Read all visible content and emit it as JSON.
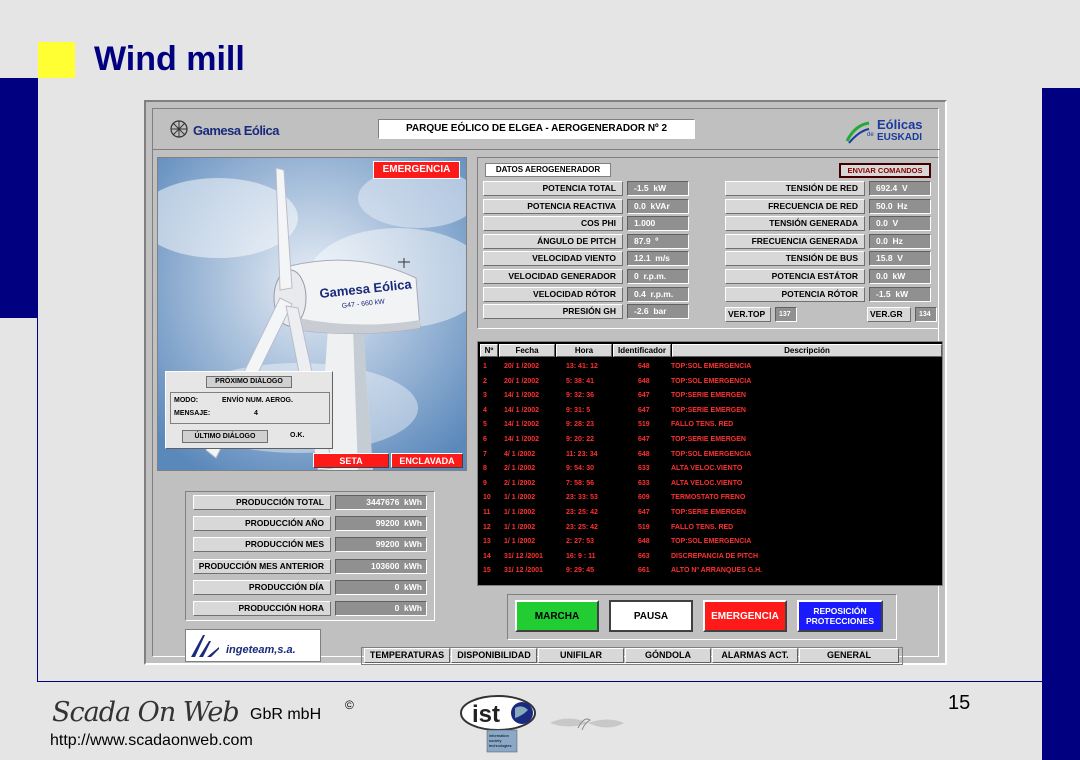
{
  "slide": {
    "title": "Wind mill",
    "page_number": "15",
    "company": "GbR mbH",
    "copyright": "©",
    "url": "http://www.scadaonweb.com",
    "logo_text": "Scada On Web",
    "ist_logo_text": "ist",
    "ist_sub": "information society technologies"
  },
  "scada": {
    "brand_left": "Gamesa Eólica",
    "title": "PARQUE EÓLICO DE ELGEA - AEROGENERADOR Nº 2",
    "brand_right_top": "Eólicas",
    "brand_right_de": "de",
    "brand_right_bottom": "EUSKADI",
    "turbine_text": "Gamesa Eólica",
    "turbine_model": "G47 - 660 kW",
    "emergency_badge": "EMERGENCIA",
    "dialog": {
      "title": "PRÓXIMO DIÁLOGO",
      "modo_label": "MODO:",
      "modo_value": "ENVÍO NUM. AEROG.",
      "mensaje_label": "MENSAJE:",
      "mensaje_value": "4",
      "ultimo_label": "ÚLTIMO DIÁLOGO",
      "ultimo_value": "O.K."
    },
    "seta": "SETA",
    "enclavada": "ENCLAVADA",
    "datos_title": "DATOS AEROGENERADOR",
    "enviar": "ENVIAR COMANDOS",
    "left_params": [
      {
        "label": "POTENCIA TOTAL",
        "value": "-1.5  kW"
      },
      {
        "label": "POTENCIA REACTIVA",
        "value": "0.0  kVAr"
      },
      {
        "label": "COS PHI",
        "value": "1.000"
      },
      {
        "label": "ÁNGULO DE PITCH",
        "value": "87.9  º"
      },
      {
        "label": "VELOCIDAD VIENTO",
        "value": "12.1  m/s"
      },
      {
        "label": "VELOCIDAD GENERADOR",
        "value": "0  r.p.m."
      },
      {
        "label": "VELOCIDAD RÓTOR",
        "value": "0.4  r.p.m."
      },
      {
        "label": "PRESIÓN GH",
        "value": "-2.6  bar"
      }
    ],
    "right_params": [
      {
        "label": "TENSIÓN DE RED",
        "value": "692.4  V"
      },
      {
        "label": "FRECUENCIA DE RED",
        "value": "50.0  Hz"
      },
      {
        "label": "TENSIÓN GENERADA",
        "value": "0.0  V"
      },
      {
        "label": "FRECUENCIA GENERADA",
        "value": "0.0  Hz"
      },
      {
        "label": "TENSIÓN DE BUS",
        "value": "15.8  V"
      },
      {
        "label": "POTENCIA ESTÁTOR",
        "value": "0.0  kW"
      },
      {
        "label": "POTENCIA RÓTOR",
        "value": "-1.5  kW"
      }
    ],
    "ver_top_label": "VER.TOP",
    "ver_top_value": "137",
    "ver_gr_label": "VER.GR",
    "ver_gr_value": "134",
    "produccion": [
      {
        "label": "PRODUCCIÓN TOTAL",
        "value": "3447676  kWh"
      },
      {
        "label": "PRODUCCIÓN AÑO",
        "value": "99200  kWh"
      },
      {
        "label": "PRODUCCIÓN MES",
        "value": "99200  kWh"
      },
      {
        "label": "PRODUCCIÓN MES ANTERIOR",
        "value": "103600  kWh"
      },
      {
        "label": "PRODUCCIÓN DÍA",
        "value": "0  kWh"
      },
      {
        "label": "PRODUCCIÓN HORA",
        "value": "0  kWh"
      }
    ],
    "alarm_headers": [
      "Nº",
      "Fecha",
      "Hora",
      "Identificador",
      "Descripción"
    ],
    "alarms": [
      {
        "n": "1",
        "fecha": "20/  1  /2002",
        "hora": "13: 41: 12",
        "id": "648",
        "desc": "TOP:SOL EMERGENCIA"
      },
      {
        "n": "2",
        "fecha": "20/  1  /2002",
        "hora": "5: 38: 41",
        "id": "648",
        "desc": "TOP:SOL EMERGENCIA"
      },
      {
        "n": "3",
        "fecha": "14/  1  /2002",
        "hora": "9: 32: 36",
        "id": "647",
        "desc": "TOP:SERIE EMERGEN"
      },
      {
        "n": "4",
        "fecha": "14/  1  /2002",
        "hora": "9: 31:  5",
        "id": "647",
        "desc": "TOP:SERIE EMERGEN"
      },
      {
        "n": "5",
        "fecha": "14/  1  /2002",
        "hora": "9: 28: 23",
        "id": "519",
        "desc": "FALLO TENS. RED"
      },
      {
        "n": "6",
        "fecha": "14/  1  /2002",
        "hora": "9: 20: 22",
        "id": "647",
        "desc": "TOP:SERIE EMERGEN"
      },
      {
        "n": "7",
        "fecha": "4/  1  /2002",
        "hora": "11: 23: 34",
        "id": "648",
        "desc": "TOP:SOL EMERGENCIA"
      },
      {
        "n": "8",
        "fecha": "2/  1  /2002",
        "hora": "9: 54: 30",
        "id": "633",
        "desc": "ALTA VELOC.VIENTO"
      },
      {
        "n": "9",
        "fecha": "2/  1  /2002",
        "hora": "7: 58: 56",
        "id": "633",
        "desc": "ALTA VELOC.VIENTO"
      },
      {
        "n": "10",
        "fecha": "1/  1  /2002",
        "hora": "23: 33: 53",
        "id": "609",
        "desc": "TERMOSTATO FRENO"
      },
      {
        "n": "11",
        "fecha": "1/  1  /2002",
        "hora": "23: 25: 42",
        "id": "647",
        "desc": "TOP:SERIE EMERGEN"
      },
      {
        "n": "12",
        "fecha": "1/  1  /2002",
        "hora": "23: 25: 42",
        "id": "519",
        "desc": "FALLO TENS. RED"
      },
      {
        "n": "13",
        "fecha": "1/  1  /2002",
        "hora": "2: 27: 53",
        "id": "648",
        "desc": "TOP:SOL EMERGENCIA"
      },
      {
        "n": "14",
        "fecha": "31/ 12 /2001",
        "hora": "16:  9 : 11",
        "id": "663",
        "desc": "DISCREPANCIA DE PITCH"
      },
      {
        "n": "15",
        "fecha": "31/ 12 /2001",
        "hora": "9: 29: 45",
        "id": "661",
        "desc": "ALTO Nº ARRANQUES G.H."
      }
    ],
    "buttons": {
      "marcha": "MARCHA",
      "pausa": "PAUSA",
      "emergencia": "EMERGENCIA",
      "reposicion_1": "REPOSICIÓN",
      "reposicion_2": "PROTECCIONES"
    },
    "ingeteam": "ingeteam,s.a.",
    "tabs": [
      "TEMPERATURAS",
      "DISPONIBILIDAD",
      "UNIFILAR",
      "GÓNDOLA",
      "ALARMAS ACT.",
      "GENERAL"
    ]
  },
  "colors": {
    "navy": "#000080",
    "yellow": "#ffff33",
    "alarm_red": "#ff3030",
    "marcha_green": "#22cc33",
    "emergencia_red": "#ff1a1a",
    "reposicion_blue": "#1a1aff"
  }
}
